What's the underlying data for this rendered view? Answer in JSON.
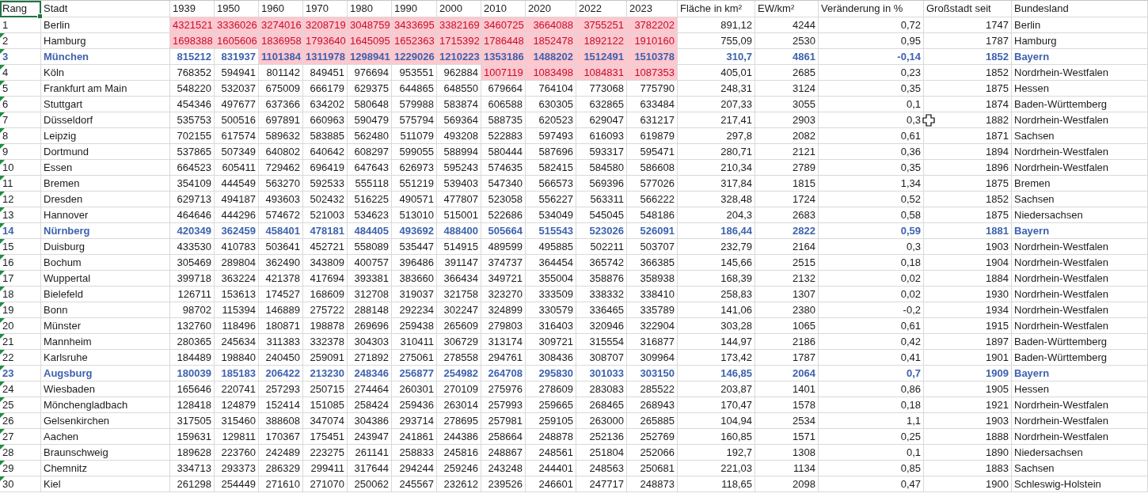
{
  "columns": [
    {
      "label": "Rang",
      "selected": true
    },
    {
      "label": "Stadt",
      "selected": false
    },
    {
      "label": "1939",
      "selected": false
    },
    {
      "label": "1950",
      "selected": false
    },
    {
      "label": "1960",
      "selected": false
    },
    {
      "label": "1970",
      "selected": false
    },
    {
      "label": "1980",
      "selected": false
    },
    {
      "label": "1990",
      "selected": false
    },
    {
      "label": "2000",
      "selected": false
    },
    {
      "label": "2010",
      "selected": false
    },
    {
      "label": "2020",
      "selected": false
    },
    {
      "label": "2022",
      "selected": false
    },
    {
      "label": "2023",
      "selected": false
    },
    {
      "label": "Fläche in km²",
      "selected": false
    },
    {
      "label": "EW/km²",
      "selected": false
    },
    {
      "label": "Veränderung in %",
      "selected": false
    },
    {
      "label": "Großstadt seit",
      "selected": false
    },
    {
      "label": "Bundesland",
      "selected": false
    }
  ],
  "rows": [
    {
      "rang": "1",
      "stadt": "Berlin",
      "warning": false,
      "emphasized": false,
      "cursor": false,
      "years": [
        "4321521",
        "3336026",
        "3274016",
        "3208719",
        "3048759",
        "3433695",
        "3382169",
        "3460725",
        "3664088",
        "3755251",
        "3782202"
      ],
      "marked": [
        true,
        true,
        true,
        true,
        true,
        true,
        true,
        true,
        true,
        true,
        true
      ],
      "flaeche": "891,12",
      "dichte": "4244",
      "veraenderung": "0,72",
      "seit": "1747",
      "land": "Berlin"
    },
    {
      "rang": "2",
      "stadt": "Hamburg",
      "warning": true,
      "emphasized": false,
      "cursor": false,
      "years": [
        "1698388",
        "1605606",
        "1836958",
        "1793640",
        "1645095",
        "1652363",
        "1715392",
        "1786448",
        "1852478",
        "1892122",
        "1910160"
      ],
      "marked": [
        true,
        true,
        true,
        true,
        true,
        true,
        true,
        true,
        true,
        true,
        true
      ],
      "flaeche": "755,09",
      "dichte": "2530",
      "veraenderung": "0,95",
      "seit": "1787",
      "land": "Hamburg"
    },
    {
      "rang": "3",
      "stadt": "München",
      "warning": true,
      "emphasized": true,
      "cursor": false,
      "years": [
        "815212",
        "831937",
        "1101384",
        "1311978",
        "1298941",
        "1229026",
        "1210223",
        "1353186",
        "1488202",
        "1512491",
        "1510378"
      ],
      "marked": [
        false,
        false,
        true,
        true,
        true,
        true,
        true,
        true,
        true,
        true,
        true
      ],
      "flaeche": "310,7",
      "dichte": "4861",
      "veraenderung": "-0,14",
      "seit": "1852",
      "land": "Bayern"
    },
    {
      "rang": "4",
      "stadt": "Köln",
      "warning": true,
      "emphasized": false,
      "cursor": false,
      "years": [
        "768352",
        "594941",
        "801142",
        "849451",
        "976694",
        "953551",
        "962884",
        "1007119",
        "1083498",
        "1084831",
        "1087353"
      ],
      "marked": [
        false,
        false,
        false,
        false,
        false,
        false,
        false,
        true,
        true,
        true,
        true
      ],
      "flaeche": "405,01",
      "dichte": "2685",
      "veraenderung": "0,23",
      "seit": "1852",
      "land": "Nordrhein-Westfalen"
    },
    {
      "rang": "5",
      "stadt": "Frankfurt am Main",
      "warning": true,
      "emphasized": false,
      "cursor": false,
      "years": [
        "548220",
        "532037",
        "675009",
        "666179",
        "629375",
        "644865",
        "648550",
        "679664",
        "764104",
        "773068",
        "775790"
      ],
      "marked": [
        false,
        false,
        false,
        false,
        false,
        false,
        false,
        false,
        false,
        false,
        false
      ],
      "flaeche": "248,31",
      "dichte": "3124",
      "veraenderung": "0,35",
      "seit": "1875",
      "land": "Hessen"
    },
    {
      "rang": "6",
      "stadt": "Stuttgart",
      "warning": true,
      "emphasized": false,
      "cursor": false,
      "years": [
        "454346",
        "497677",
        "637366",
        "634202",
        "580648",
        "579988",
        "583874",
        "606588",
        "630305",
        "632865",
        "633484"
      ],
      "marked": [
        false,
        false,
        false,
        false,
        false,
        false,
        false,
        false,
        false,
        false,
        false
      ],
      "flaeche": "207,33",
      "dichte": "3055",
      "veraenderung": "0,1",
      "seit": "1874",
      "land": "Baden-Württemberg"
    },
    {
      "rang": "7",
      "stadt": "Düsseldorf",
      "warning": true,
      "emphasized": false,
      "cursor": true,
      "years": [
        "535753",
        "500516",
        "697891",
        "660963",
        "590479",
        "575794",
        "569364",
        "588735",
        "620523",
        "629047",
        "631217"
      ],
      "marked": [
        false,
        false,
        false,
        false,
        false,
        false,
        false,
        false,
        false,
        false,
        false
      ],
      "flaeche": "217,41",
      "dichte": "2903",
      "veraenderung": "0,3",
      "seit": "1882",
      "land": "Nordrhein-Westfalen"
    },
    {
      "rang": "8",
      "stadt": "Leipzig",
      "warning": true,
      "emphasized": false,
      "cursor": false,
      "years": [
        "702155",
        "617574",
        "589632",
        "583885",
        "562480",
        "511079",
        "493208",
        "522883",
        "597493",
        "616093",
        "619879"
      ],
      "marked": [
        false,
        false,
        false,
        false,
        false,
        false,
        false,
        false,
        false,
        false,
        false
      ],
      "flaeche": "297,8",
      "dichte": "2082",
      "veraenderung": "0,61",
      "seit": "1871",
      "land": "Sachsen"
    },
    {
      "rang": "9",
      "stadt": "Dortmund",
      "warning": true,
      "emphasized": false,
      "cursor": false,
      "years": [
        "537865",
        "507349",
        "640802",
        "640642",
        "608297",
        "599055",
        "588994",
        "580444",
        "587696",
        "593317",
        "595471"
      ],
      "marked": [
        false,
        false,
        false,
        false,
        false,
        false,
        false,
        false,
        false,
        false,
        false
      ],
      "flaeche": "280,71",
      "dichte": "2121",
      "veraenderung": "0,36",
      "seit": "1894",
      "land": "Nordrhein-Westfalen"
    },
    {
      "rang": "10",
      "stadt": "Essen",
      "warning": true,
      "emphasized": false,
      "cursor": false,
      "years": [
        "664523",
        "605411",
        "729462",
        "696419",
        "647643",
        "626973",
        "595243",
        "574635",
        "582415",
        "584580",
        "586608"
      ],
      "marked": [
        false,
        false,
        false,
        false,
        false,
        false,
        false,
        false,
        false,
        false,
        false
      ],
      "flaeche": "210,34",
      "dichte": "2789",
      "veraenderung": "0,35",
      "seit": "1896",
      "land": "Nordrhein-Westfalen"
    },
    {
      "rang": "11",
      "stadt": "Bremen",
      "warning": true,
      "emphasized": false,
      "cursor": false,
      "years": [
        "354109",
        "444549",
        "563270",
        "592533",
        "555118",
        "551219",
        "539403",
        "547340",
        "566573",
        "569396",
        "577026"
      ],
      "marked": [
        false,
        false,
        false,
        false,
        false,
        false,
        false,
        false,
        false,
        false,
        false
      ],
      "flaeche": "317,84",
      "dichte": "1815",
      "veraenderung": "1,34",
      "seit": "1875",
      "land": "Bremen"
    },
    {
      "rang": "12",
      "stadt": "Dresden",
      "warning": true,
      "emphasized": false,
      "cursor": false,
      "years": [
        "629713",
        "494187",
        "493603",
        "502432",
        "516225",
        "490571",
        "477807",
        "523058",
        "556227",
        "563311",
        "566222"
      ],
      "marked": [
        false,
        false,
        false,
        false,
        false,
        false,
        false,
        false,
        false,
        false,
        false
      ],
      "flaeche": "328,48",
      "dichte": "1724",
      "veraenderung": "0,52",
      "seit": "1852",
      "land": "Sachsen"
    },
    {
      "rang": "13",
      "stadt": "Hannover",
      "warning": true,
      "emphasized": false,
      "cursor": false,
      "years": [
        "464646",
        "444296",
        "574672",
        "521003",
        "534623",
        "513010",
        "515001",
        "522686",
        "534049",
        "545045",
        "548186"
      ],
      "marked": [
        false,
        false,
        false,
        false,
        false,
        false,
        false,
        false,
        false,
        false,
        false
      ],
      "flaeche": "204,3",
      "dichte": "2683",
      "veraenderung": "0,58",
      "seit": "1875",
      "land": "Niedersachsen"
    },
    {
      "rang": "14",
      "stadt": "Nürnberg",
      "warning": true,
      "emphasized": true,
      "cursor": false,
      "years": [
        "420349",
        "362459",
        "458401",
        "478181",
        "484405",
        "493692",
        "488400",
        "505664",
        "515543",
        "523026",
        "526091"
      ],
      "marked": [
        false,
        false,
        false,
        false,
        false,
        false,
        false,
        false,
        false,
        false,
        false
      ],
      "flaeche": "186,44",
      "dichte": "2822",
      "veraenderung": "0,59",
      "seit": "1881",
      "land": "Bayern"
    },
    {
      "rang": "15",
      "stadt": "Duisburg",
      "warning": true,
      "emphasized": false,
      "cursor": false,
      "years": [
        "433530",
        "410783",
        "503641",
        "452721",
        "558089",
        "535447",
        "514915",
        "489599",
        "495885",
        "502211",
        "503707"
      ],
      "marked": [
        false,
        false,
        false,
        false,
        false,
        false,
        false,
        false,
        false,
        false,
        false
      ],
      "flaeche": "232,79",
      "dichte": "2164",
      "veraenderung": "0,3",
      "seit": "1903",
      "land": "Nordrhein-Westfalen"
    },
    {
      "rang": "16",
      "stadt": "Bochum",
      "warning": true,
      "emphasized": false,
      "cursor": false,
      "years": [
        "305469",
        "289804",
        "362490",
        "343809",
        "400757",
        "396486",
        "391147",
        "374737",
        "364454",
        "365742",
        "366385"
      ],
      "marked": [
        false,
        false,
        false,
        false,
        false,
        false,
        false,
        false,
        false,
        false,
        false
      ],
      "flaeche": "145,66",
      "dichte": "2515",
      "veraenderung": "0,18",
      "seit": "1904",
      "land": "Nordrhein-Westfalen"
    },
    {
      "rang": "17",
      "stadt": "Wuppertal",
      "warning": true,
      "emphasized": false,
      "cursor": false,
      "years": [
        "399718",
        "363224",
        "421378",
        "417694",
        "393381",
        "383660",
        "366434",
        "349721",
        "355004",
        "358876",
        "358938"
      ],
      "marked": [
        false,
        false,
        false,
        false,
        false,
        false,
        false,
        false,
        false,
        false,
        false
      ],
      "flaeche": "168,39",
      "dichte": "2132",
      "veraenderung": "0,02",
      "seit": "1884",
      "land": "Nordrhein-Westfalen"
    },
    {
      "rang": "18",
      "stadt": "Bielefeld",
      "warning": true,
      "emphasized": false,
      "cursor": false,
      "years": [
        "126711",
        "153613",
        "174527",
        "168609",
        "312708",
        "319037",
        "321758",
        "323270",
        "333509",
        "338332",
        "338410"
      ],
      "marked": [
        false,
        false,
        false,
        false,
        false,
        false,
        false,
        false,
        false,
        false,
        false
      ],
      "flaeche": "258,83",
      "dichte": "1307",
      "veraenderung": "0,02",
      "seit": "1930",
      "land": "Nordrhein-Westfalen"
    },
    {
      "rang": "19",
      "stadt": "Bonn",
      "warning": true,
      "emphasized": false,
      "cursor": false,
      "years": [
        "98702",
        "115394",
        "146889",
        "275722",
        "288148",
        "292234",
        "302247",
        "324899",
        "330579",
        "336465",
        "335789"
      ],
      "marked": [
        false,
        false,
        false,
        false,
        false,
        false,
        false,
        false,
        false,
        false,
        false
      ],
      "flaeche": "141,06",
      "dichte": "2380",
      "veraenderung": "-0,2",
      "seit": "1934",
      "land": "Nordrhein-Westfalen"
    },
    {
      "rang": "20",
      "stadt": "Münster",
      "warning": true,
      "emphasized": false,
      "cursor": false,
      "years": [
        "132760",
        "118496",
        "180871",
        "198878",
        "269696",
        "259438",
        "265609",
        "279803",
        "316403",
        "320946",
        "322904"
      ],
      "marked": [
        false,
        false,
        false,
        false,
        false,
        false,
        false,
        false,
        false,
        false,
        false
      ],
      "flaeche": "303,28",
      "dichte": "1065",
      "veraenderung": "0,61",
      "seit": "1915",
      "land": "Nordrhein-Westfalen"
    },
    {
      "rang": "21",
      "stadt": "Mannheim",
      "warning": true,
      "emphasized": false,
      "cursor": false,
      "years": [
        "280365",
        "245634",
        "311383",
        "332378",
        "304303",
        "310411",
        "306729",
        "313174",
        "309721",
        "315554",
        "316877"
      ],
      "marked": [
        false,
        false,
        false,
        false,
        false,
        false,
        false,
        false,
        false,
        false,
        false
      ],
      "flaeche": "144,97",
      "dichte": "2186",
      "veraenderung": "0,42",
      "seit": "1897",
      "land": "Baden-Württemberg"
    },
    {
      "rang": "22",
      "stadt": "Karlsruhe",
      "warning": true,
      "emphasized": false,
      "cursor": false,
      "years": [
        "184489",
        "198840",
        "240450",
        "259091",
        "271892",
        "275061",
        "278558",
        "294761",
        "308436",
        "308707",
        "309964"
      ],
      "marked": [
        false,
        false,
        false,
        false,
        false,
        false,
        false,
        false,
        false,
        false,
        false
      ],
      "flaeche": "173,42",
      "dichte": "1787",
      "veraenderung": "0,41",
      "seit": "1901",
      "land": "Baden-Württemberg"
    },
    {
      "rang": "23",
      "stadt": "Augsburg",
      "warning": true,
      "emphasized": true,
      "cursor": false,
      "years": [
        "180039",
        "185183",
        "206422",
        "213230",
        "248346",
        "256877",
        "254982",
        "264708",
        "295830",
        "301033",
        "303150"
      ],
      "marked": [
        false,
        false,
        false,
        false,
        false,
        false,
        false,
        false,
        false,
        false,
        false
      ],
      "flaeche": "146,85",
      "dichte": "2064",
      "veraenderung": "0,7",
      "seit": "1909",
      "land": "Bayern"
    },
    {
      "rang": "24",
      "stadt": "Wiesbaden",
      "warning": true,
      "emphasized": false,
      "cursor": false,
      "years": [
        "165646",
        "220741",
        "257293",
        "250715",
        "274464",
        "260301",
        "270109",
        "275976",
        "278609",
        "283083",
        "285522"
      ],
      "marked": [
        false,
        false,
        false,
        false,
        false,
        false,
        false,
        false,
        false,
        false,
        false
      ],
      "flaeche": "203,87",
      "dichte": "1401",
      "veraenderung": "0,86",
      "seit": "1905",
      "land": "Hessen"
    },
    {
      "rang": "25",
      "stadt": "Mönchengladbach",
      "warning": true,
      "emphasized": false,
      "cursor": false,
      "years": [
        "128418",
        "124879",
        "152414",
        "151085",
        "258424",
        "259436",
        "263014",
        "257993",
        "259665",
        "268465",
        "268943"
      ],
      "marked": [
        false,
        false,
        false,
        false,
        false,
        false,
        false,
        false,
        false,
        false,
        false
      ],
      "flaeche": "170,47",
      "dichte": "1578",
      "veraenderung": "0,18",
      "seit": "1921",
      "land": "Nordrhein-Westfalen"
    },
    {
      "rang": "26",
      "stadt": "Gelsenkirchen",
      "warning": true,
      "emphasized": false,
      "cursor": false,
      "years": [
        "317505",
        "315460",
        "388608",
        "347074",
        "304386",
        "293714",
        "278695",
        "257981",
        "259105",
        "263000",
        "265885"
      ],
      "marked": [
        false,
        false,
        false,
        false,
        false,
        false,
        false,
        false,
        false,
        false,
        false
      ],
      "flaeche": "104,94",
      "dichte": "2534",
      "veraenderung": "1,1",
      "seit": "1903",
      "land": "Nordrhein-Westfalen"
    },
    {
      "rang": "27",
      "stadt": "Aachen",
      "warning": true,
      "emphasized": false,
      "cursor": false,
      "years": [
        "159631",
        "129811",
        "170367",
        "175451",
        "243947",
        "241861",
        "244386",
        "258664",
        "248878",
        "252136",
        "252769"
      ],
      "marked": [
        false,
        false,
        false,
        false,
        false,
        false,
        false,
        false,
        false,
        false,
        false
      ],
      "flaeche": "160,85",
      "dichte": "1571",
      "veraenderung": "0,25",
      "seit": "1888",
      "land": "Nordrhein-Westfalen"
    },
    {
      "rang": "28",
      "stadt": "Braunschweig",
      "warning": true,
      "emphasized": false,
      "cursor": false,
      "years": [
        "189628",
        "223760",
        "242489",
        "223275",
        "261141",
        "258833",
        "245816",
        "248867",
        "248561",
        "251804",
        "252066"
      ],
      "marked": [
        false,
        false,
        false,
        false,
        false,
        false,
        false,
        false,
        false,
        false,
        false
      ],
      "flaeche": "192,7",
      "dichte": "1308",
      "veraenderung": "0,1",
      "seit": "1890",
      "land": "Niedersachsen"
    },
    {
      "rang": "29",
      "stadt": "Chemnitz",
      "warning": true,
      "emphasized": false,
      "cursor": false,
      "years": [
        "334713",
        "293373",
        "286329",
        "299411",
        "317644",
        "294244",
        "259246",
        "243248",
        "244401",
        "248563",
        "250681"
      ],
      "marked": [
        false,
        false,
        false,
        false,
        false,
        false,
        false,
        false,
        false,
        false,
        false
      ],
      "flaeche": "221,03",
      "dichte": "1134",
      "veraenderung": "0,85",
      "seit": "1883",
      "land": "Sachsen"
    },
    {
      "rang": "30",
      "stadt": "Kiel",
      "warning": true,
      "emphasized": false,
      "cursor": false,
      "years": [
        "261298",
        "254449",
        "271610",
        "271070",
        "250062",
        "245567",
        "232612",
        "239526",
        "246601",
        "247717",
        "248873"
      ],
      "marked": [
        false,
        false,
        false,
        false,
        false,
        false,
        false,
        false,
        false,
        false,
        false
      ],
      "flaeche": "118,65",
      "dichte": "2098",
      "veraenderung": "0,47",
      "seit": "1900",
      "land": "Schleswig-Holstein"
    }
  ]
}
